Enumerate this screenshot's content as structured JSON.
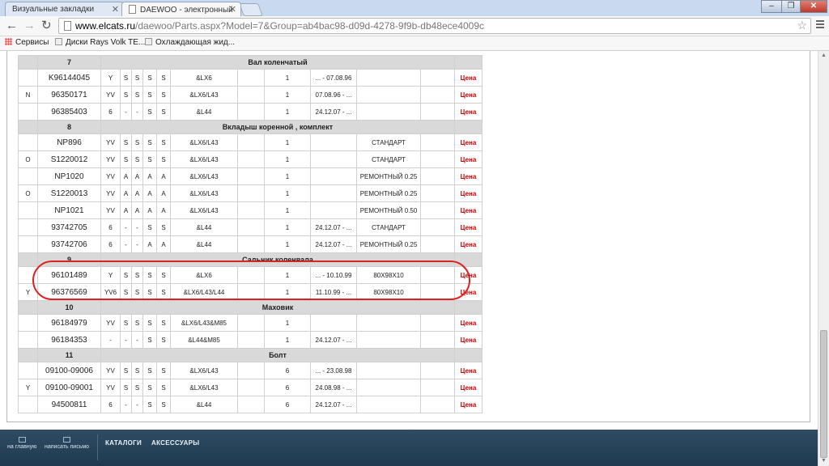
{
  "browser": {
    "tabs": [
      {
        "label": "Визуальные закладки"
      },
      {
        "label": "DAEWOO - электронный"
      }
    ],
    "url_host": "www.elcats.ru",
    "url_path": "/daewoo/Parts.aspx?Model=7&Group=ab4bac98-d09d-4278-9f9b-db48ece4009c",
    "bookmarks": [
      "Сервисы",
      "Диски Rays Volk TE...",
      "Охлаждающая жид..."
    ]
  },
  "parts_table": {
    "price_label": "Цена",
    "highlight_color": "#dd2222",
    "price_color": "#cc0000",
    "rows": [
      {
        "type": "group",
        "num": "7",
        "name": "Вал коленчатый"
      },
      {
        "type": "part",
        "mark": "",
        "number": "K96144045",
        "c1": "Y",
        "c2": "S",
        "c3": "S",
        "c4": "S",
        "c5": "S",
        "engine": "&LX6",
        "qty": "1",
        "date": "... - 07.08.96",
        "note": ""
      },
      {
        "type": "part",
        "mark": "N",
        "number": "96350171",
        "c1": "YV",
        "c2": "S",
        "c3": "S",
        "c4": "S",
        "c5": "S",
        "engine": "&LX6/L43",
        "qty": "1",
        "date": "07.08.96 - ...",
        "note": ""
      },
      {
        "type": "part",
        "mark": "",
        "number": "96385403",
        "c1": "6",
        "c2": "-",
        "c3": "-",
        "c4": "S",
        "c5": "S",
        "engine": "&L44",
        "qty": "1",
        "date": "24.12.07 - ...",
        "note": ""
      },
      {
        "type": "group",
        "num": "8",
        "name": "Вкладыш коренной , комплект"
      },
      {
        "type": "part",
        "mark": "",
        "number": "NP896",
        "c1": "YV",
        "c2": "S",
        "c3": "S",
        "c4": "S",
        "c5": "S",
        "engine": "&LX6/L43",
        "qty": "1",
        "date": "",
        "note": "СТАНДАРТ"
      },
      {
        "type": "part",
        "mark": "O",
        "number": "S1220012",
        "c1": "YV",
        "c2": "S",
        "c3": "S",
        "c4": "S",
        "c5": "S",
        "engine": "&LX6/L43",
        "qty": "1",
        "date": "",
        "note": "СТАНДАРТ"
      },
      {
        "type": "part",
        "mark": "",
        "number": "NP1020",
        "c1": "YV",
        "c2": "A",
        "c3": "A",
        "c4": "A",
        "c5": "A",
        "engine": "&LX6/L43",
        "qty": "1",
        "date": "",
        "note": "РЕМОНТНЫЙ 0.25"
      },
      {
        "type": "part",
        "mark": "O",
        "number": "S1220013",
        "c1": "YV",
        "c2": "A",
        "c3": "A",
        "c4": "A",
        "c5": "A",
        "engine": "&LX6/L43",
        "qty": "1",
        "date": "",
        "note": "РЕМОНТНЫЙ 0.25"
      },
      {
        "type": "part",
        "mark": "",
        "number": "NP1021",
        "c1": "YV",
        "c2": "A",
        "c3": "A",
        "c4": "A",
        "c5": "A",
        "engine": "&LX6/L43",
        "qty": "1",
        "date": "",
        "note": "РЕМОНТНЫЙ 0.50"
      },
      {
        "type": "part",
        "mark": "",
        "number": "93742705",
        "c1": "6",
        "c2": "-",
        "c3": "-",
        "c4": "S",
        "c5": "S",
        "engine": "&L44",
        "qty": "1",
        "date": "24.12.07 - ...",
        "note": "СТАНДАРТ"
      },
      {
        "type": "part",
        "mark": "",
        "number": "93742706",
        "c1": "6",
        "c2": "-",
        "c3": "-",
        "c4": "A",
        "c5": "A",
        "engine": "&L44",
        "qty": "1",
        "date": "24.12.07 - ...",
        "note": "РЕМОНТНЫЙ 0.25"
      },
      {
        "type": "group",
        "num": "9",
        "name": "Сальник коленвала"
      },
      {
        "type": "part",
        "mark": "",
        "number": "96101489",
        "c1": "Y",
        "c2": "S",
        "c3": "S",
        "c4": "S",
        "c5": "S",
        "engine": "&LX6",
        "qty": "1",
        "date": "... - 10.10.99",
        "note": "80X98X10"
      },
      {
        "type": "part",
        "mark": "Y",
        "number": "96376569",
        "c1": "YV6",
        "c2": "S",
        "c3": "S",
        "c4": "S",
        "c5": "S",
        "engine": "&LX6/L43/L44",
        "qty": "1",
        "date": "11.10.99 - ...",
        "note": "80X98X10"
      },
      {
        "type": "group",
        "num": "10",
        "name": "Маховик"
      },
      {
        "type": "part",
        "mark": "",
        "number": "96184979",
        "c1": "YV",
        "c2": "S",
        "c3": "S",
        "c4": "S",
        "c5": "S",
        "engine": "&LX6/L43&M85",
        "qty": "1",
        "date": "",
        "note": ""
      },
      {
        "type": "part",
        "mark": "",
        "number": "96184353",
        "c1": "-",
        "c2": "-",
        "c3": "-",
        "c4": "S",
        "c5": "S",
        "engine": "&L44&M85",
        "qty": "1",
        "date": "24.12.07 - ...",
        "note": ""
      },
      {
        "type": "group",
        "num": "11",
        "name": "Болт"
      },
      {
        "type": "part",
        "mark": "",
        "number": "09100-09006",
        "c1": "YV",
        "c2": "S",
        "c3": "S",
        "c4": "S",
        "c5": "S",
        "engine": "&LX6/L43",
        "qty": "6",
        "date": "... - 23.08.98",
        "note": ""
      },
      {
        "type": "part",
        "mark": "Y",
        "number": "09100-09001",
        "c1": "YV",
        "c2": "S",
        "c3": "S",
        "c4": "S",
        "c5": "S",
        "engine": "&LX6/L43",
        "qty": "6",
        "date": "24.08.98 - ...",
        "note": ""
      },
      {
        "type": "part",
        "mark": "",
        "number": "94500811",
        "c1": "6",
        "c2": "-",
        "c3": "-",
        "c4": "S",
        "c5": "S",
        "engine": "&L44",
        "qty": "6",
        "date": "24.12.07 - ...",
        "note": ""
      }
    ]
  },
  "footer": {
    "home_label": "на главную",
    "write_label": "написать письмо",
    "catalogs_label": "КАТАЛОГИ",
    "accessories_label": "АКСЕССУАРЫ"
  }
}
